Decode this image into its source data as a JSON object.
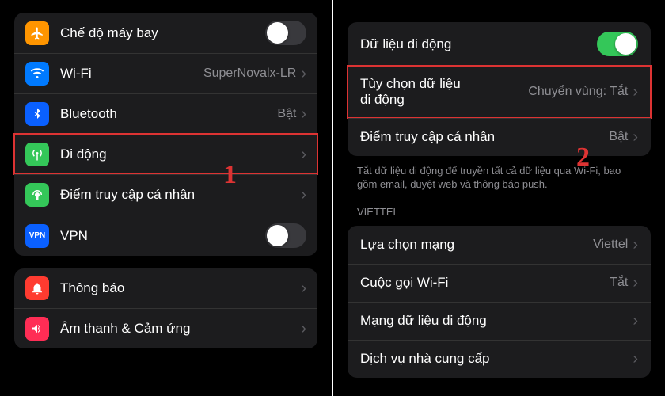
{
  "left": {
    "rows": [
      {
        "icon": "airplane-icon",
        "label": "Chế độ máy bay",
        "toggle": "off"
      },
      {
        "icon": "wifi-icon",
        "label": "Wi-Fi",
        "value": "SuperNovalx-LR"
      },
      {
        "icon": "bluetooth-icon",
        "label": "Bluetooth",
        "value": "Bật"
      },
      {
        "icon": "cellular-icon",
        "label": "Di động"
      },
      {
        "icon": "hotspot-icon",
        "label": "Điểm truy cập cá nhân"
      },
      {
        "icon": "vpn-icon",
        "label": "VPN",
        "toggle": "off"
      }
    ],
    "group2": [
      {
        "icon": "notifications-icon",
        "label": "Thông báo"
      },
      {
        "icon": "sounds-icon",
        "label": "Âm thanh & Cảm ứng"
      }
    ],
    "marker": "1"
  },
  "right": {
    "topRows": [
      {
        "label": "Dữ liệu di động",
        "toggle": "on"
      },
      {
        "label": "Tùy chọn dữ liệu\ndi động",
        "value": "Chuyển vùng: Tắt"
      },
      {
        "label": "Điểm truy cập cá nhân",
        "value": "Bật"
      }
    ],
    "helper": "Tắt dữ liệu di động để truyền tất cả dữ liệu qua Wi-Fi, bao gồm email, duyệt web và thông báo push.",
    "sectionHeader": "VIETTEL",
    "carrierRows": [
      {
        "label": "Lựa chọn mạng",
        "value": "Viettel"
      },
      {
        "label": "Cuộc gọi Wi-Fi",
        "value": "Tắt"
      },
      {
        "label": "Mạng dữ liệu di động"
      },
      {
        "label": "Dịch vụ nhà cung cấp"
      }
    ],
    "marker": "2"
  }
}
